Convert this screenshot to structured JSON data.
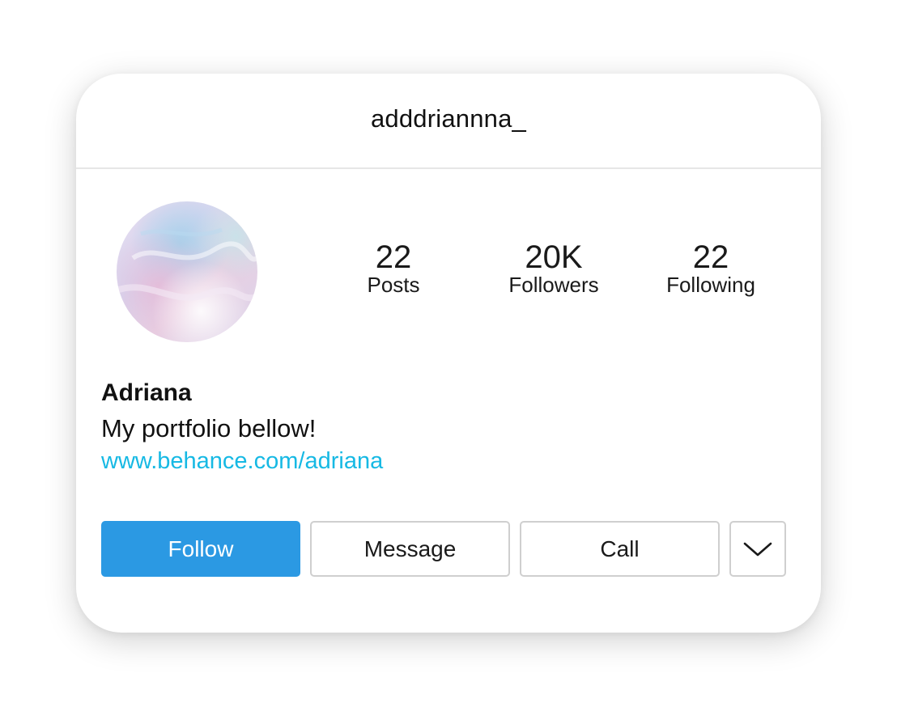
{
  "profile": {
    "username": "adddriannna_",
    "display_name": "Adriana",
    "bio": "My portfolio bellow!",
    "link": "www.behance.com/adriana"
  },
  "stats": {
    "posts": {
      "value": "22",
      "label": "Posts"
    },
    "followers": {
      "value": "20K",
      "label": "Followers"
    },
    "following": {
      "value": "22",
      "label": "Following"
    }
  },
  "actions": {
    "follow_label": "Follow",
    "message_label": "Message",
    "call_label": "Call",
    "more_icon": "chevron-down-icon"
  },
  "colors": {
    "follow_button": "#2b99e3",
    "link": "#16b9e4",
    "border": "#cfcfcf"
  }
}
